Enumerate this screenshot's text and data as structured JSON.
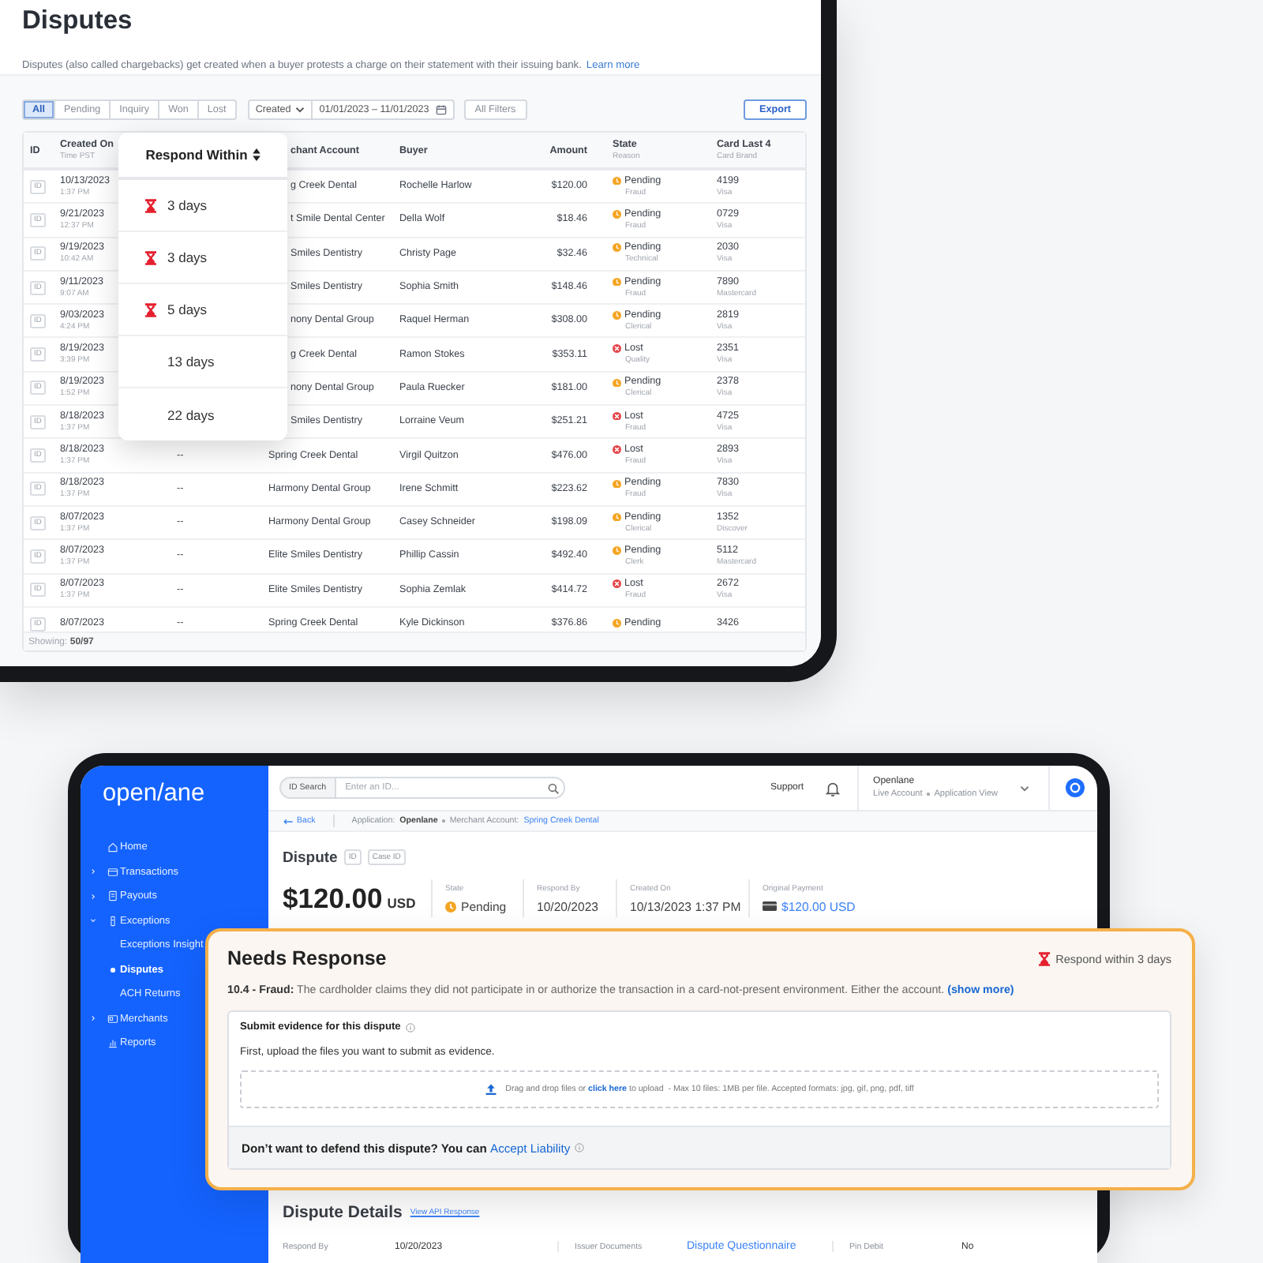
{
  "top_screen": {
    "title": "Disputes",
    "description": "Disputes (also called chargebacks) get created when a buyer protests a charge on their statement with their issuing bank.",
    "learn_more": "Learn more",
    "filter_tabs": [
      {
        "label": "All",
        "selected": true
      },
      {
        "label": "Pending",
        "selected": false
      },
      {
        "label": "Inquiry",
        "selected": false
      },
      {
        "label": "Won",
        "selected": false
      },
      {
        "label": "Lost",
        "selected": false
      }
    ],
    "date_filter": {
      "field": "Created",
      "range": "01/01/2023 – 11/01/2023"
    },
    "all_filters": "All Filters",
    "export": "Export",
    "table": {
      "columns": [
        {
          "title": "ID"
        },
        {
          "title": "Created On",
          "subtitle": "Time PST"
        },
        {
          "title": "chant Account"
        },
        {
          "title": "Buyer"
        },
        {
          "title": "Amount"
        },
        {
          "title": "State",
          "subtitle": "Reason"
        },
        {
          "title": "Card Last 4",
          "subtitle": "Card Brand"
        }
      ],
      "rows": [
        {
          "id_label": "ID",
          "created": "10/13/2023",
          "time": "1:37 PM",
          "merchant": "g Creek Dental",
          "buyer": "Rochelle Harlow",
          "amount": "$120.00",
          "state": "Pending",
          "kind": "pending",
          "reason": "Fraud",
          "card_last4": "4199",
          "card_brand": "Visa"
        },
        {
          "id_label": "ID",
          "created": "9/21/2023",
          "time": "12:37 PM",
          "merchant": "t Smile Dental Center",
          "buyer": "Della Wolf",
          "amount": "$18.46",
          "state": "Pending",
          "kind": "pending",
          "reason": "Fraud",
          "card_last4": "0729",
          "card_brand": "Visa"
        },
        {
          "id_label": "ID",
          "created": "9/19/2023",
          "time": "10:42 AM",
          "merchant": "Smiles Dentistry",
          "buyer": "Christy Page",
          "amount": "$32.46",
          "state": "Pending",
          "kind": "pending",
          "reason": "Technical",
          "card_last4": "2030",
          "card_brand": "Visa"
        },
        {
          "id_label": "ID",
          "created": "9/11/2023",
          "time": "9:07 AM",
          "merchant": "Smiles Dentistry",
          "buyer": "Sophia Smith",
          "amount": "$148.46",
          "state": "Pending",
          "kind": "pending",
          "reason": "Fraud",
          "card_last4": "7890",
          "card_brand": "Mastercard"
        },
        {
          "id_label": "ID",
          "created": "9/03/2023",
          "time": "4:24 PM",
          "merchant": "nony Dental Group",
          "buyer": "Raquel Herman",
          "amount": "$308.00",
          "state": "Pending",
          "kind": "pending",
          "reason": "Clerical",
          "card_last4": "2819",
          "card_brand": "Visa"
        },
        {
          "id_label": "ID",
          "created": "8/19/2023",
          "time": "3:39 PM",
          "merchant": "g Creek Dental",
          "buyer": "Ramon Stokes",
          "amount": "$353.11",
          "state": "Lost",
          "kind": "lost",
          "reason": "Quality",
          "card_last4": "2351",
          "card_brand": "Visa"
        },
        {
          "id_label": "ID",
          "created": "8/19/2023",
          "time": "1:52 PM",
          "merchant": "nony Dental Group",
          "buyer": "Paula Ruecker",
          "amount": "$181.00",
          "state": "Pending",
          "kind": "pending",
          "reason": "Clerical",
          "card_last4": "2378",
          "card_brand": "Visa"
        },
        {
          "id_label": "ID",
          "created": "8/18/2023",
          "time": "1:37 PM",
          "merchant": "Smiles Dentistry",
          "buyer": "Lorraine Veum",
          "amount": "$251.21",
          "state": "Lost",
          "kind": "lost",
          "reason": "Fraud",
          "card_last4": "4725",
          "card_brand": "Visa"
        },
        {
          "id_label": "ID",
          "created": "8/18/2023",
          "time": "1:37 PM",
          "respond_by": "--",
          "merchant": "Spring Creek Dental",
          "buyer": "Virgil Quitzon",
          "amount": "$476.00",
          "state": "Lost",
          "kind": "lost",
          "reason": "Fraud",
          "card_last4": "2893",
          "card_brand": "Visa"
        },
        {
          "id_label": "ID",
          "created": "8/18/2023",
          "time": "1:37 PM",
          "respond_by": "--",
          "merchant": "Harmony Dental Group",
          "buyer": "Irene Schmitt",
          "amount": "$223.62",
          "state": "Pending",
          "kind": "pending",
          "reason": "Fraud",
          "card_last4": "7830",
          "card_brand": "Visa"
        },
        {
          "id_label": "ID",
          "created": "8/07/2023",
          "time": "1:37 PM",
          "respond_by": "--",
          "merchant": "Harmony Dental Group",
          "buyer": "Casey Schneider",
          "amount": "$198.09",
          "state": "Pending",
          "kind": "pending",
          "reason": "Clerical",
          "card_last4": "1352",
          "card_brand": "Discover"
        },
        {
          "id_label": "ID",
          "created": "8/07/2023",
          "time": "1:37 PM",
          "respond_by": "--",
          "merchant": "Elite Smiles Dentistry",
          "buyer": "Phillip Cassin",
          "amount": "$492.40",
          "state": "Pending",
          "kind": "pending",
          "reason": "Clerk",
          "card_last4": "5112",
          "card_brand": "Mastercard"
        },
        {
          "id_label": "ID",
          "created": "8/07/2023",
          "time": "1:37 PM",
          "respond_by": "--",
          "merchant": "Elite Smiles Dentistry",
          "buyer": "Sophia Zemlak",
          "amount": "$414.72",
          "state": "Lost",
          "kind": "lost",
          "reason": "Fraud",
          "card_last4": "2672",
          "card_brand": "Visa"
        },
        {
          "id_label": "ID",
          "created": "8/07/2023",
          "respond_by": "--",
          "merchant": "Spring Creek Dental",
          "buyer": "Kyle Dickinson",
          "amount": "$376.86",
          "state": "Pending",
          "kind": "pending",
          "card_last4": "3426"
        }
      ],
      "footer": "Showing: **50/97**"
    },
    "respond_popover": {
      "title": "Respond Within",
      "options": [
        {
          "label": "3 days",
          "urgent": true
        },
        {
          "label": "3 days",
          "urgent": true
        },
        {
          "label": "5 days",
          "urgent": true
        },
        {
          "label": "13 days",
          "urgent": false
        },
        {
          "label": "22 days",
          "urgent": false
        }
      ]
    }
  },
  "bottom_screen": {
    "logo": "open/ane",
    "nav": [
      {
        "label": "Home",
        "selected": false
      },
      {
        "label": "Transactions",
        "expanded": false,
        "selected": false
      },
      {
        "label": "Payouts",
        "expanded": false,
        "selected": false
      },
      {
        "label": "Exceptions",
        "expanded": true,
        "selected": false,
        "children": [
          {
            "label": "Exceptions Insight",
            "selected": false
          },
          {
            "label": "Disputes",
            "selected": true
          },
          {
            "label": "ACH Returns",
            "selected": false
          }
        ]
      },
      {
        "label": "Merchants",
        "expanded": false,
        "selected": false
      },
      {
        "label": "Reports",
        "selected": false
      }
    ],
    "header": {
      "id_search_label": "ID Search",
      "id_search_placeholder": "Enter an ID...",
      "support": "Support",
      "account_name": "Openlane",
      "account_mode": "Live Account",
      "account_view": "Application View"
    },
    "breadcrumb": {
      "back": "Back",
      "application_label": "Application:",
      "application": "Openlane",
      "merchant_label": "Merchant Account:",
      "merchant": "Spring Creek Dental"
    },
    "dispute": {
      "title": "Dispute",
      "chips": [
        "ID",
        "Case ID"
      ],
      "amount": "$120.00",
      "currency": "USD",
      "stats": [
        {
          "label": "State",
          "value": "Pending",
          "kind": "pending"
        },
        {
          "label": "Respond By",
          "value": "10/20/2023",
          "kind": "text"
        },
        {
          "label": "Created On",
          "value": "10/13/2023 1:37 PM",
          "kind": "text"
        },
        {
          "label": "Original Payment",
          "value": "$120.00 USD",
          "kind": "payment"
        }
      ]
    },
    "details": {
      "title": "Dispute Details",
      "api_link": "View API Response",
      "fields": [
        {
          "label": "Respond By",
          "value": "10/20/2023",
          "kind": "text"
        },
        {
          "label": "Issuer Documents",
          "value": "Dispute Questionnaire",
          "kind": "link"
        },
        {
          "label": "Pin Debit",
          "value": "No",
          "kind": "text"
        }
      ]
    }
  },
  "needs_response": {
    "title": "Needs Response",
    "deadline": "Respond within 3 days",
    "reason": "**10.4 - Fraud:** The cardholder claims they did not participate in or authorize the transaction in a card-not-present environment. Either the account.",
    "show_more": "(show more)",
    "evidence": {
      "title": "Submit evidence for this dispute",
      "instruction": "First, upload the files you want to submit as evidence.",
      "upload_before": "Drag and drop files or",
      "upload_link": "click here",
      "upload_after": "to upload  - Max 10 files: 1MB per file. Accepted formats: jpg, gif, png, pdf, tiff"
    },
    "liability_prompt": "Don’t want to defend this dispute? You can",
    "liability_link": "Accept Liability"
  }
}
